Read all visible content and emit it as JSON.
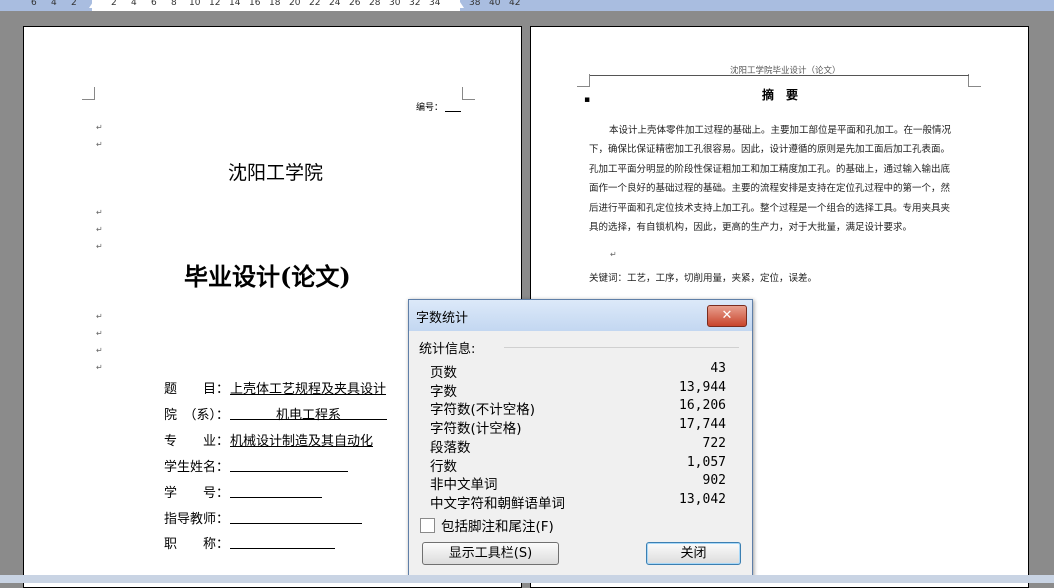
{
  "ruler": {
    "ticks": [
      "6",
      "4",
      "2",
      "2",
      "4",
      "6",
      "8",
      "10",
      "12",
      "14",
      "16",
      "18",
      "20",
      "22",
      "24",
      "26",
      "28",
      "30",
      "32",
      "34",
      "38",
      "40",
      "42"
    ]
  },
  "left_page": {
    "serial_label": "编号：",
    "school": "沈阳工学院",
    "title": "毕业设计(论文)",
    "fields": [
      {
        "label": "题　　目：",
        "value": "上壳体工艺规程及夹具设计"
      },
      {
        "label": "院　（系）：",
        "value": "机电工程系"
      },
      {
        "label": "专　　业：",
        "value": "机械设计制造及其自动化"
      },
      {
        "label": "学生姓名：",
        "value": ""
      },
      {
        "label": "学　　号：",
        "value": ""
      },
      {
        "label": "指导教师：",
        "value": ""
      },
      {
        "label": "职　　称：",
        "value": ""
      }
    ]
  },
  "right_page": {
    "header": "沈阳工学院毕业设计（论文）",
    "abstract_title": "摘　要",
    "abstract_lines": [
      "本设计上壳体零件加工过程的基础上。主要加工部位是平面和孔加工。在一般情况",
      "下，确保比保证精密加工孔很容易。因此，设计遵循的原则是先加工面后加工孔表面。",
      "孔加工平面分明显的阶段性保证粗加工和加工精度加工孔。的基础上，通过输入输出底",
      "面作一个良好的基础过程的基础。主要的流程安排是支持在定位孔过程中的第一个，然",
      "后进行平面和孔定位技术支持上加工孔。整个过程是一个组合的选择工具。专用夹具夹",
      "具的选择，有自锁机构，因此，更高的生产力，对于大批量，满足设计要求。"
    ],
    "keywords": "关键词：工艺，工序，切削用量，夹紧，定位，误差。"
  },
  "dialog": {
    "title": "字数统计",
    "close_glyph": "✕",
    "stats_heading": "统计信息:",
    "stats": [
      {
        "label": "页数",
        "value": "43"
      },
      {
        "label": "字数",
        "value": "13,944"
      },
      {
        "label": "字符数(不计空格)",
        "value": "16,206"
      },
      {
        "label": "字符数(计空格)",
        "value": "17,744"
      },
      {
        "label": "段落数",
        "value": "722"
      },
      {
        "label": "行数",
        "value": "1,057"
      },
      {
        "label": "非中文单词",
        "value": "902"
      },
      {
        "label": "中文字符和朝鲜语单词",
        "value": "13,042"
      }
    ],
    "checkbox_label": "包括脚注和尾注(F)",
    "show_toolbar_button": "显示工具栏(S)",
    "close_button": "关闭"
  }
}
